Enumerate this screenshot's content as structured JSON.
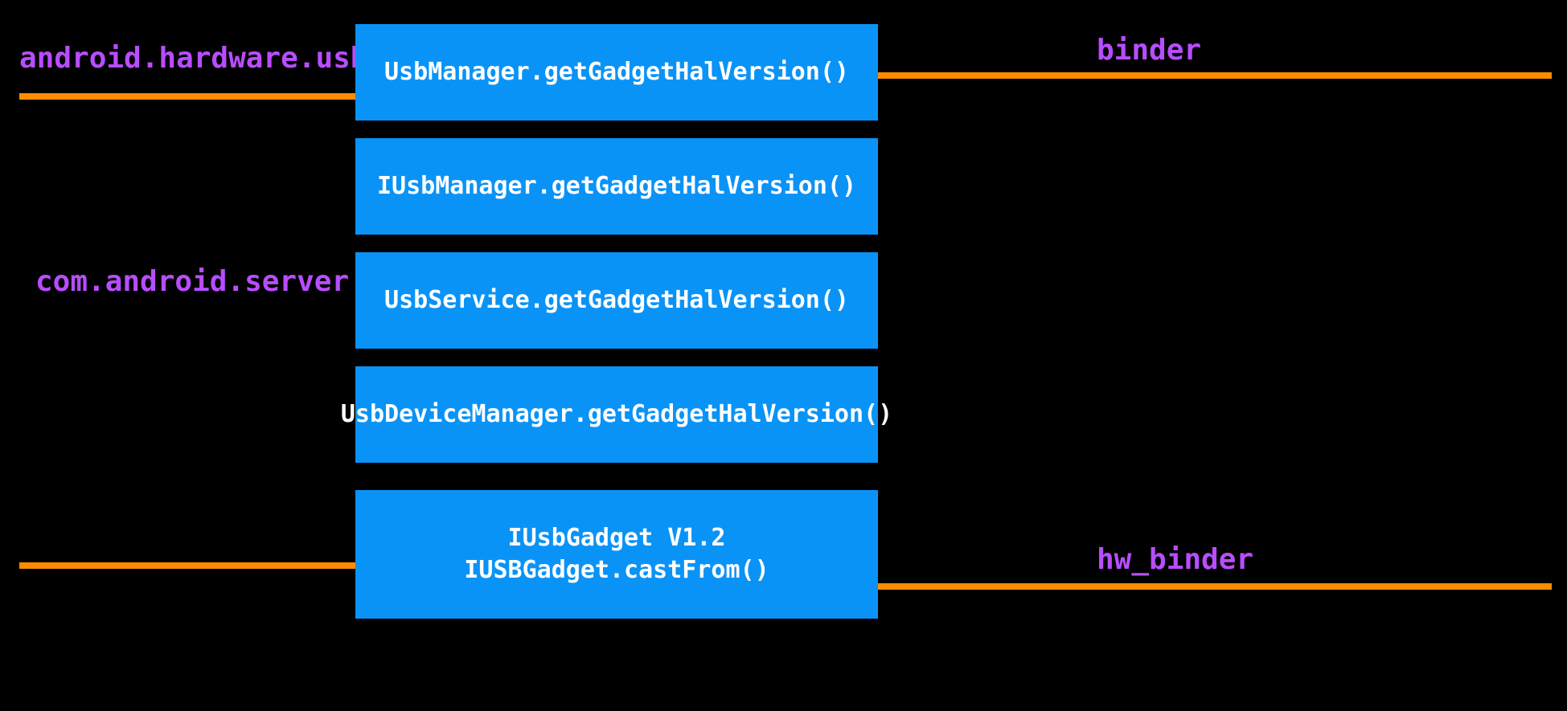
{
  "boxes": {
    "b1": "UsbManager.getGadgetHalVersion()",
    "b2": "IUsbManager.getGadgetHalVersion()",
    "b3": "UsbService.getGadgetHalVersion()",
    "b4": "UsbDeviceManager.getGadgetHalVersion()",
    "b5": "IUsbGadget V1.2\nIUSBGadget.castFrom()"
  },
  "labels": {
    "top_left": "android.hardware.usb",
    "top_right": "binder",
    "mid_left": "com.android.server.usb",
    "bottom_right": "hw_binder"
  },
  "colors": {
    "box_bg": "#0a93f7",
    "rule": "#ff8c00",
    "label_fg": "#b84dff",
    "bg": "#000000"
  }
}
